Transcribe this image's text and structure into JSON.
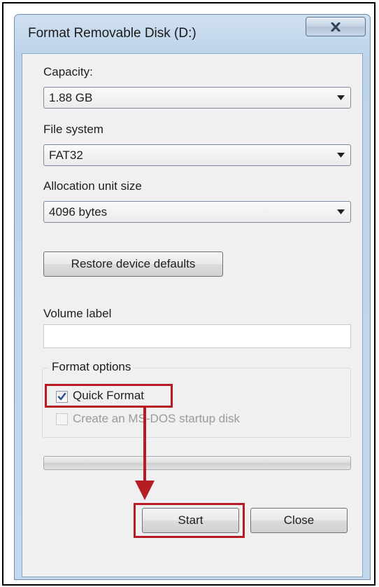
{
  "window": {
    "title": "Format Removable Disk (D:)",
    "close_symbol": "x"
  },
  "capacity": {
    "label": "Capacity:",
    "value": "1.88 GB"
  },
  "file_system": {
    "label": "File system",
    "value": "FAT32"
  },
  "allocation": {
    "label": "Allocation unit size",
    "value": "4096 bytes"
  },
  "restore_button": "Restore device defaults",
  "volume_label": {
    "label": "Volume label",
    "value": ""
  },
  "format_options": {
    "title": "Format options",
    "quick_format": {
      "label": "Quick Format",
      "checked": true
    },
    "msdos": {
      "label": "Create an MS-DOS startup disk",
      "checked": false,
      "enabled": false
    }
  },
  "progress": {
    "percent": 0
  },
  "buttons": {
    "start": "Start",
    "close": "Close"
  },
  "annotation_color": "#b71c24"
}
